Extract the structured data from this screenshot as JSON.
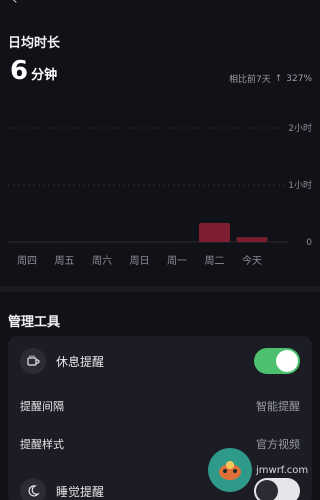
{
  "header": {
    "title": "",
    "back_icon": "back-arrow-icon"
  },
  "daily": {
    "section_title": "日均时长",
    "value": "6",
    "unit": "分钟",
    "compare_label": "相比前7天",
    "compare_change": "327%"
  },
  "chart_data": {
    "type": "bar",
    "categories": [
      "周四",
      "周五",
      "周六",
      "周日",
      "周一",
      "周二",
      "今天"
    ],
    "values": [
      0,
      0,
      0,
      0,
      0,
      20,
      5
    ],
    "y_unit": "minutes",
    "ylim": [
      0,
      120
    ],
    "y_tick_labels": [
      "2小时",
      "1小时",
      "0"
    ],
    "bar_color": "#7d1f31"
  },
  "tools": {
    "section_title": "管理工具",
    "rest_reminder": {
      "label": "休息提醒",
      "icon": "cup-icon",
      "enabled": true,
      "toggle_color": "#4cc06e"
    },
    "interval": {
      "label": "提醒间隔",
      "value": "智能提醒"
    },
    "style": {
      "label": "提醒样式",
      "value": "官方视频"
    },
    "sleep_reminder": {
      "label": "睡觉提醒",
      "icon": "moon-icon",
      "enabled": false,
      "toggle_color": "#e6e6ea"
    }
  },
  "watermark": {
    "text": "jmwrf.com",
    "icon": "gamepad-icon",
    "color": "#2f9a8a"
  }
}
